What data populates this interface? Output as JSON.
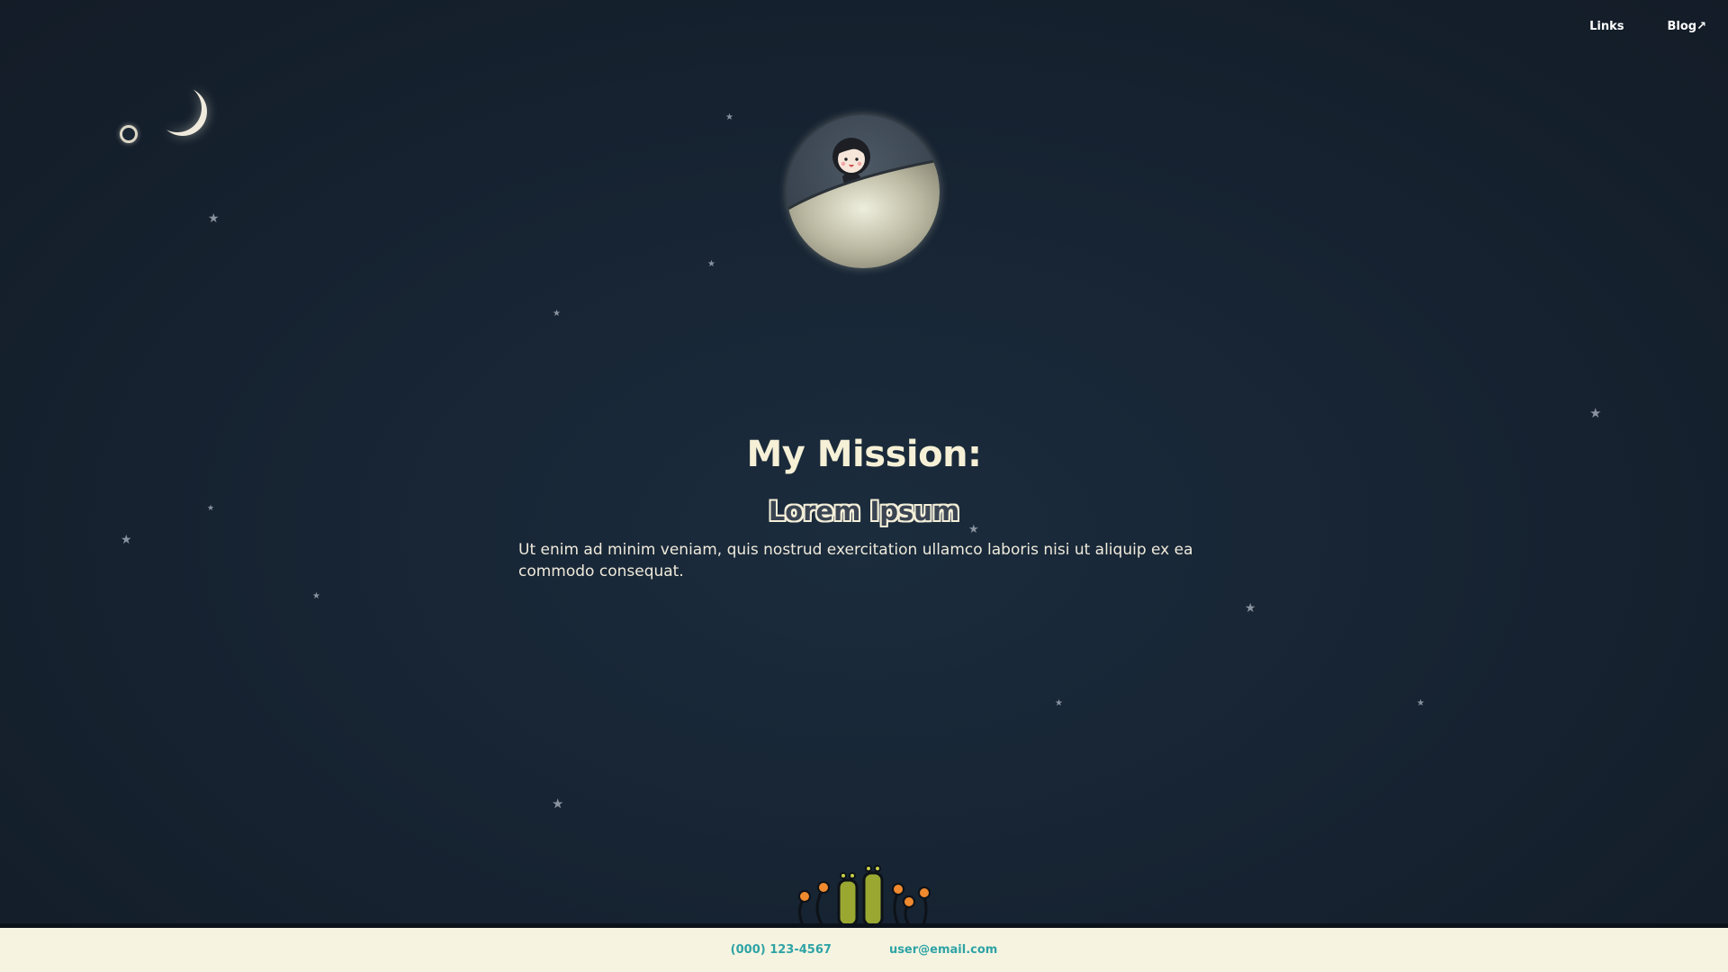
{
  "nav": {
    "links_label": "Links",
    "blog_label": "Blog↗"
  },
  "main": {
    "title": "My Mission:",
    "subtitle": "Lorem Ipsum",
    "body": "Ut enim ad minim veniam, quis nostrud exercitation ullamco laboris nisi ut aliquip ex ea commodo consequat."
  },
  "footer": {
    "phone": "(000) 123-4567",
    "email": "user@email.com"
  },
  "icons": {
    "moon": "crescent-moon-icon",
    "small_moon": "small-moon-icon",
    "star": "star-icon",
    "planet": "planet-icon",
    "astronaut": "astronaut-icon",
    "aliens": "aliens-icon"
  },
  "colors": {
    "background": "#172433",
    "heading": "#f5f0d6",
    "footer_bg": "#f6f4e1",
    "footer_link": "#2fa3a5"
  }
}
